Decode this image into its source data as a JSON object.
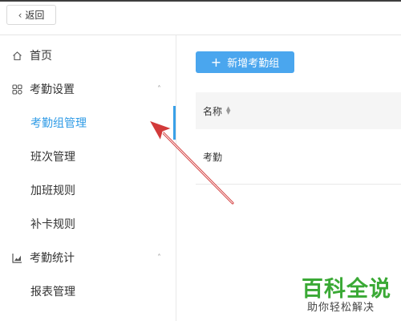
{
  "header": {
    "back_label": "返回"
  },
  "sidebar": {
    "items": [
      {
        "label": "首页",
        "icon": "home-icon"
      },
      {
        "label": "考勤设置",
        "icon": "settings-icon",
        "expanded": true
      },
      {
        "label": "考勤组管理",
        "active": true
      },
      {
        "label": "班次管理"
      },
      {
        "label": "加班规则"
      },
      {
        "label": "补卡规则"
      },
      {
        "label": "考勤统计",
        "icon": "chart-icon",
        "expanded": true
      },
      {
        "label": "报表管理"
      }
    ]
  },
  "main": {
    "add_button_label": "新增考勤组",
    "table": {
      "columns": [
        "名称"
      ],
      "rows": [
        [
          "考勤"
        ]
      ]
    }
  },
  "watermark": {
    "title": "百科全说",
    "subtitle": "助你轻松解决"
  },
  "colors": {
    "accent": "#39a0e8",
    "primary_button": "#4aa6ee",
    "annotation_arrow": "#d23a3a",
    "watermark_green": "#3aa935"
  }
}
